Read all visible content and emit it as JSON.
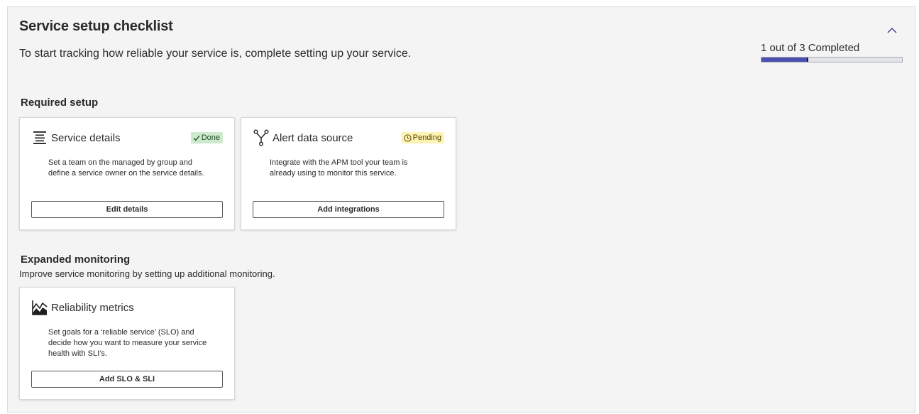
{
  "header": {
    "title": "Service setup checklist",
    "description": "To start tracking how reliable your service is, complete setting up your service.",
    "collapse_icon": "chevron-up-icon"
  },
  "progress": {
    "label": "1 out of 3 Completed",
    "completed": 1,
    "total": 3,
    "fill_color": "#4a4fb0"
  },
  "required": {
    "title": "Required setup",
    "cards": [
      {
        "title": "Service details",
        "icon": "list-align-icon",
        "badge": "Done",
        "badge_icon": "checkmark-icon",
        "body": "Set a team on the managed by group and define a service owner on the service details.",
        "button": "Edit details"
      },
      {
        "title": "Alert data source",
        "icon": "branch-icon",
        "badge": "Pending",
        "badge_icon": "clock-icon",
        "body": "Integrate with the APM tool your team is already using to monitor this service.",
        "button": "Add integrations"
      }
    ]
  },
  "expanded": {
    "title": "Expanded monitoring",
    "subtitle": "Improve service monitoring by setting up additional monitoring.",
    "cards": [
      {
        "title": "Reliability metrics",
        "icon": "line-chart-icon",
        "body": "Set goals for a ‘reliable service’ (SLO) and decide how you want to measure your service health with SLI’s.",
        "button": "Add SLO & SLI"
      }
    ]
  },
  "colors": {
    "done_badge_bg": "#cfe9cf",
    "pending_badge_bg": "#fdf3b5"
  }
}
